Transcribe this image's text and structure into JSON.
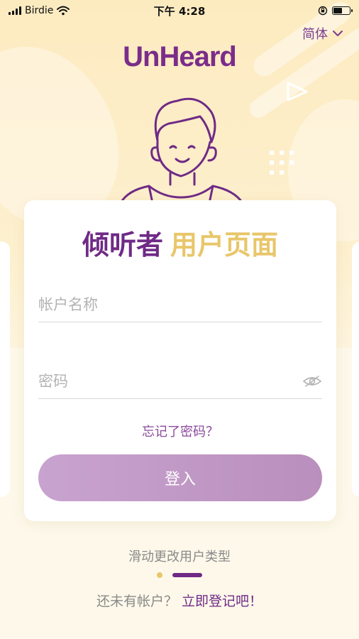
{
  "status_bar": {
    "carrier": "Birdie",
    "time": "下午 4:28"
  },
  "language": {
    "label": "简体"
  },
  "logo": {
    "text": "UnHeard"
  },
  "card": {
    "title_part1": "倾听者",
    "title_part2": "用户页面",
    "username_placeholder": "帐户名称",
    "password_placeholder": "密码",
    "forgot_label": "忘记了密码？",
    "login_label": "登入"
  },
  "footer": {
    "swipe_hint": "滑动更改用户类型",
    "no_account_text": "还未有帐户？",
    "register_link": "立即登记吧！"
  },
  "colors": {
    "brand_purple": "#6f2a86",
    "accent_gold": "#e8c66a",
    "button_purple": "#c9a3cf"
  },
  "icons": {
    "signal": "signal-icon",
    "wifi": "wifi-icon",
    "lock_rotation": "orientation-lock-icon",
    "battery": "battery-icon",
    "chevron": "chevron-down-icon",
    "eye": "eye-icon",
    "avatar": "listener-avatar-illustration"
  }
}
